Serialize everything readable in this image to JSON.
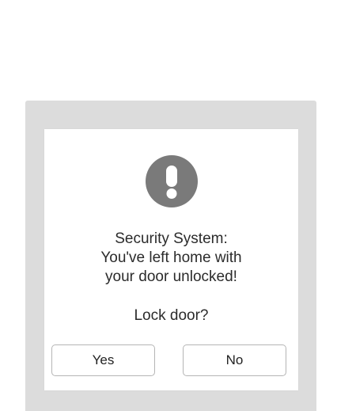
{
  "dialog": {
    "message_lines": [
      "Security System:",
      "You've left home with",
      "your door unlocked!"
    ],
    "question": "Lock door?",
    "yes_label": "Yes",
    "no_label": "No",
    "icon": "alert-exclamation-icon"
  },
  "colors": {
    "backdrop": "#dcdcdc",
    "dialog_background": "#ffffff",
    "icon_fill": "#7a7a7a",
    "text": "#2b2b2b",
    "button_border": "#b5b5b5"
  }
}
